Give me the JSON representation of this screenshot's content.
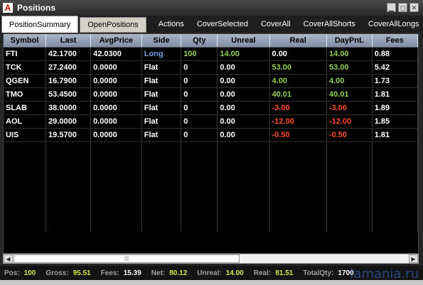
{
  "window": {
    "logo": "A",
    "title": "Positions",
    "controls": [
      "▁",
      "◻",
      "✕"
    ]
  },
  "tabs": [
    {
      "label": "PositionSummary",
      "active": true
    },
    {
      "label": "OpenPositions",
      "active": false
    }
  ],
  "actions": [
    "Actions",
    "CoverSelected",
    "CoverAll",
    "CoverAllShorts",
    "CoverAllLongs"
  ],
  "columns": [
    "Symbol",
    "Last",
    "AvgPrice",
    "Side",
    "Qty",
    "Unreal",
    "Real",
    "DayPnL",
    "Fees"
  ],
  "rows": [
    {
      "symbol": "FTI",
      "last": "42.1700",
      "avg": "42.0300",
      "side": "Long",
      "qty": "100",
      "unreal": "14.00",
      "real": "0.00",
      "daypnl": "14.00",
      "fees": "0.88"
    },
    {
      "symbol": "TCK",
      "last": "27.2400",
      "avg": "0.0000",
      "side": "Flat",
      "qty": "0",
      "unreal": "0.00",
      "real": "53.00",
      "daypnl": "53.00",
      "fees": "5.42"
    },
    {
      "symbol": "QGEN",
      "last": "16.7900",
      "avg": "0.0000",
      "side": "Flat",
      "qty": "0",
      "unreal": "0.00",
      "real": "4.00",
      "daypnl": "4.00",
      "fees": "1.73"
    },
    {
      "symbol": "TMO",
      "last": "53.4500",
      "avg": "0.0000",
      "side": "Flat",
      "qty": "0",
      "unreal": "0.00",
      "real": "40.01",
      "daypnl": "40.01",
      "fees": "1.81"
    },
    {
      "symbol": "SLAB",
      "last": "38.0000",
      "avg": "0.0000",
      "side": "Flat",
      "qty": "0",
      "unreal": "0.00",
      "real": "-3.00",
      "daypnl": "-3.00",
      "fees": "1.89"
    },
    {
      "symbol": "AOL",
      "last": "29.0000",
      "avg": "0.0000",
      "side": "Flat",
      "qty": "0",
      "unreal": "0.00",
      "real": "-12.00",
      "daypnl": "-12.00",
      "fees": "1.85"
    },
    {
      "symbol": "UIS",
      "last": "19.5700",
      "avg": "0.0000",
      "side": "Flat",
      "qty": "0",
      "unreal": "0.00",
      "real": "-0.50",
      "daypnl": "-0.50",
      "fees": "1.81"
    }
  ],
  "colors": {
    "positive": "#8fd14f",
    "negative": "#ff4a2a",
    "neutral": "#ffffff",
    "long": "#6fa0e0",
    "status_green": "#d7e84a"
  },
  "status": [
    {
      "label": "Pos:",
      "value": "100",
      "color": "#d7e84a"
    },
    {
      "label": "Gross:",
      "value": "95.51",
      "color": "#d7e84a"
    },
    {
      "label": "Fees:",
      "value": "15.39",
      "color": "#ffffff"
    },
    {
      "label": "Net:",
      "value": "80.12",
      "color": "#d7e84a"
    },
    {
      "label": "Unreal:",
      "value": "14.00",
      "color": "#d7e84a"
    },
    {
      "label": "Real:",
      "value": "81.51",
      "color": "#d7e84a"
    },
    {
      "label": "TotalQty:",
      "value": "1700",
      "color": "#ffffff"
    }
  ],
  "watermark": "lamania.ru",
  "scrollbar": {
    "left_arrow": "◀",
    "right_arrow": "▶",
    "thumb_grip": "|||"
  }
}
